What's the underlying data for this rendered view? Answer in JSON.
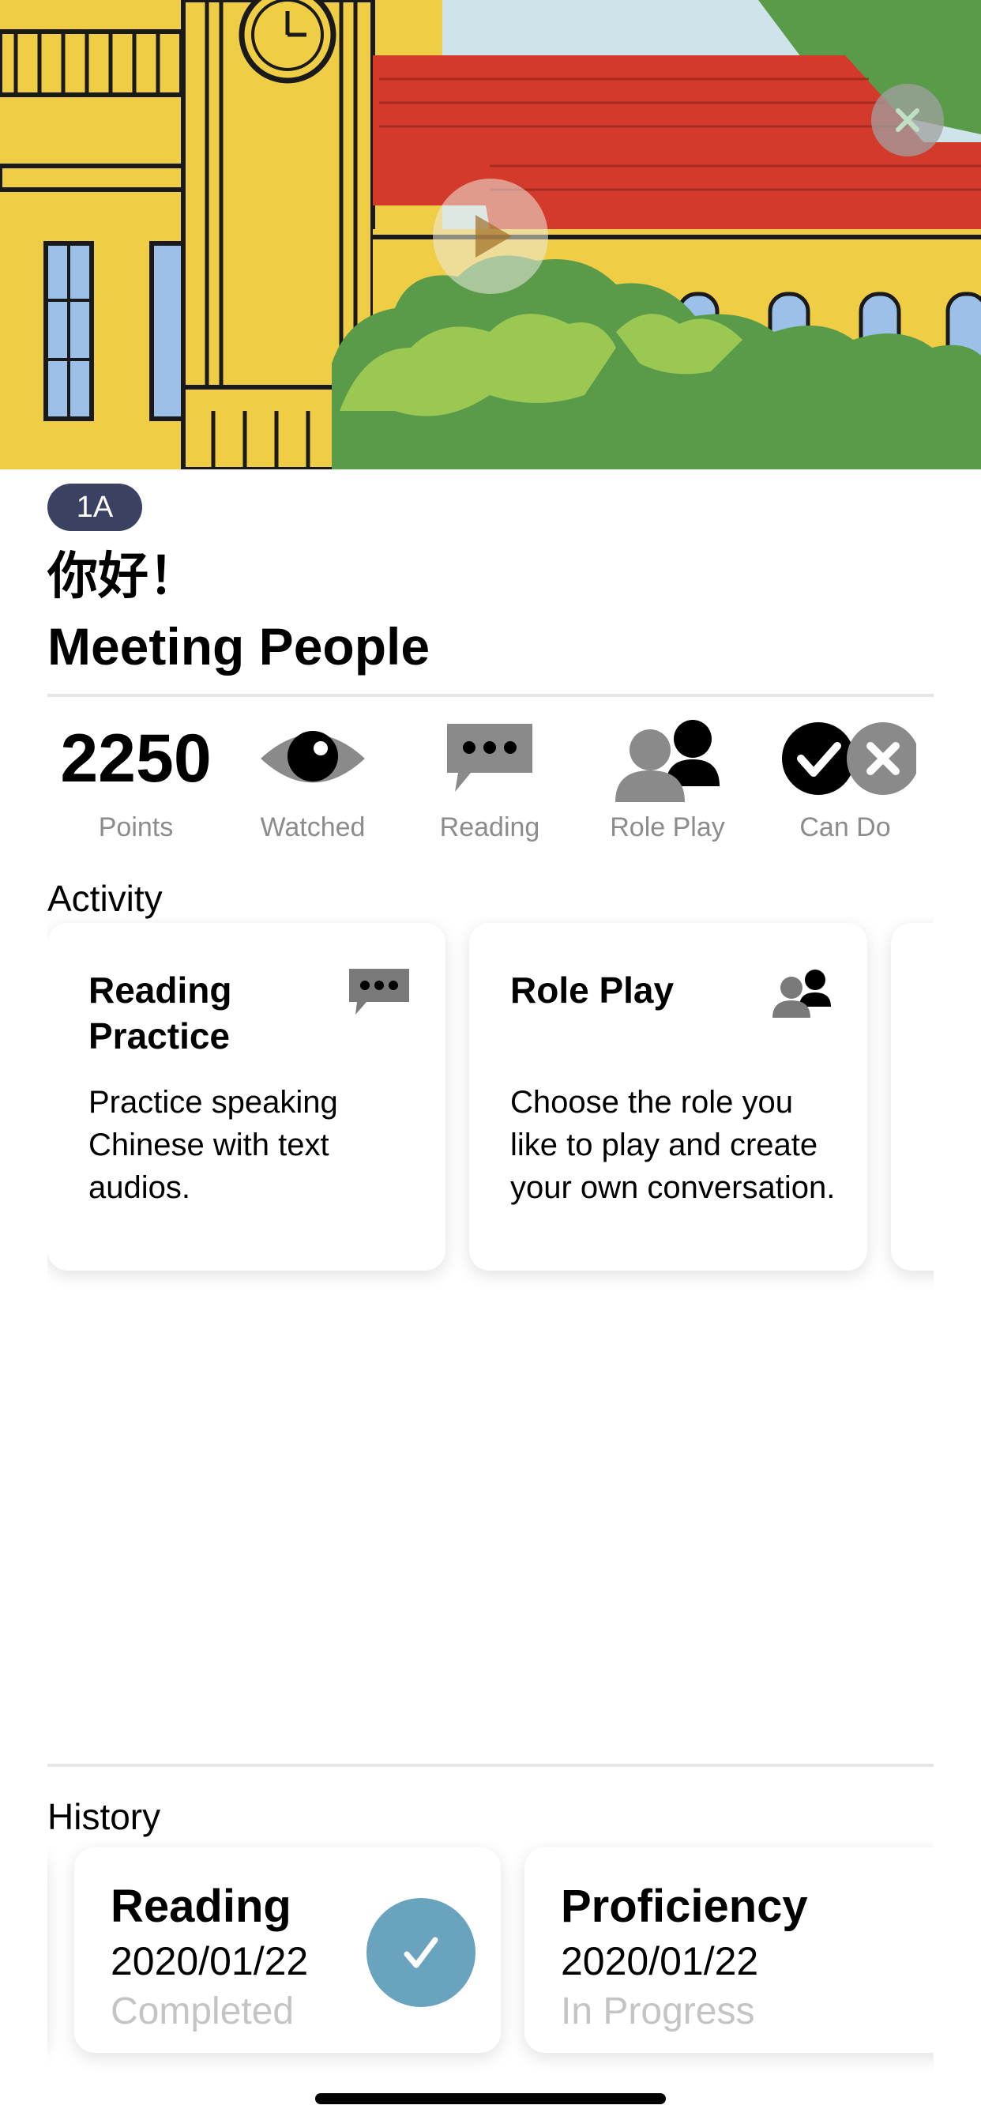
{
  "lesson": {
    "level": "1A",
    "title_cn": "你好！",
    "title_en": "Meeting People"
  },
  "stats": {
    "points_value": "2250",
    "points_label": "Points",
    "watched_label": "Watched",
    "reading_label": "Reading",
    "roleplay_label": "Role Play",
    "cando_label": "Can Do"
  },
  "activity": {
    "section_title": "Activity",
    "cards": [
      {
        "title": "Reading Practice",
        "description": "Practice speaking Chinese with text audios.",
        "icon": "speech-bubble-icon"
      },
      {
        "title": "Role Play",
        "description": "Choose the role you like to play and create your own conversation.",
        "icon": "people-icon"
      }
    ]
  },
  "history": {
    "section_title": "History",
    "cards": [
      {
        "title": "Reading",
        "date": "2020/01/22",
        "status": "Completed",
        "icon": "check-icon"
      },
      {
        "title": "Proficiency",
        "date": "2020/01/22",
        "status": "In Progress"
      }
    ]
  },
  "colors": {
    "badge_bg": "#3b4261",
    "check_circle": "#6aa3bd",
    "label_gray": "#8c8c8c",
    "status_gray": "#c4c4c4"
  }
}
